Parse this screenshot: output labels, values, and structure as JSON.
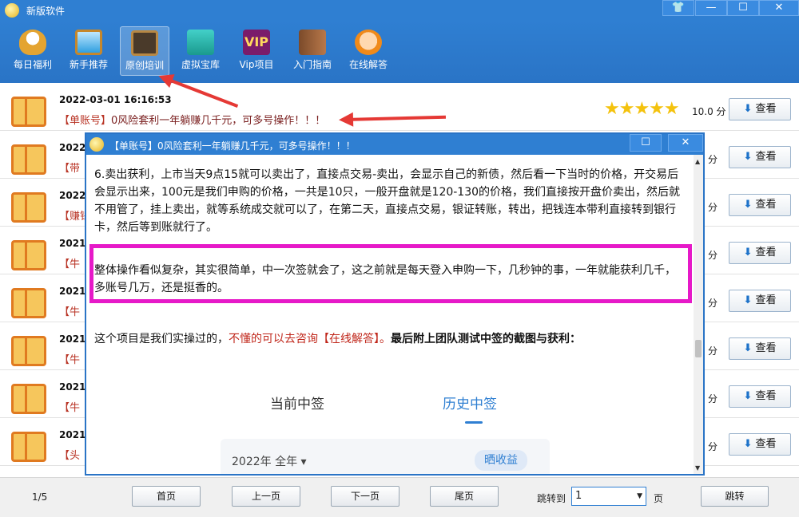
{
  "app": {
    "title": "新版软件"
  },
  "window_controls": {
    "skin": "👕",
    "minimize": "—",
    "maximize": "☐",
    "close": "✕"
  },
  "toolbar": {
    "items": [
      {
        "label": "每日福利",
        "icon": "lucky-cat-icon"
      },
      {
        "label": "新手推荐",
        "icon": "monitor-icon"
      },
      {
        "label": "原创培训",
        "icon": "blackboard-icon",
        "active": true
      },
      {
        "label": "虚拟宝库",
        "icon": "warehouse-icon"
      },
      {
        "label": "Vip项目",
        "icon": "vip-icon",
        "icon_text": "VIP"
      },
      {
        "label": "入门指南",
        "icon": "guide-book-icon"
      },
      {
        "label": "在线解答",
        "icon": "headset-icon"
      }
    ]
  },
  "list": {
    "rows": [
      {
        "date": "2022-03-01 16:16:53",
        "tag": "【单账号】",
        "title": "0风险套利一年躺赚几千元，可多号操作！！！",
        "stars": "★★★★★",
        "score": "10.0 分",
        "action": "查看"
      },
      {
        "date": "2022",
        "tag": "【带",
        "title": "",
        "score": "分",
        "action": "查看"
      },
      {
        "date": "2022",
        "tag": "【赚钱",
        "title": "",
        "score": "分",
        "action": "查看"
      },
      {
        "date": "2021",
        "tag": "【牛",
        "title": "",
        "score": "分",
        "action": "查看"
      },
      {
        "date": "2021",
        "tag": "【牛",
        "title": "",
        "score": "分",
        "action": "查看"
      },
      {
        "date": "2021",
        "tag": "【牛",
        "title": "",
        "score": "分",
        "action": "查看"
      },
      {
        "date": "2021",
        "tag": "【牛",
        "title": "",
        "score": "分",
        "action": "查看"
      },
      {
        "date": "2021",
        "tag": "【头",
        "title": "",
        "score": "分",
        "action": "查看"
      }
    ]
  },
  "popup": {
    "title": "【单账号】0风险套利一年躺赚几千元，可多号操作！！！",
    "maximize": "☐",
    "close": "✕",
    "para1": "6.卖出获利，上市当天9点15就可以卖出了，直接点交易-卖出，会显示自己的新债，然后看一下当时的价格，开交易后会显示出来，100元是我们申购的价格，一共是10只，一般开盘就是120-130的价格，我们直接按开盘价卖出，然后就不用管了，挂上卖出，就等系统成交就可以了，在第二天，直接点交易，银证转账，转出，把钱连本带利直接转到银行卡，然后等到账就行了。",
    "para2": "整体操作看似复杂，其实很简单，中一次签就会了，这之前就是每天登入申购一下，几秒钟的事，一年就能获利几千，多账号几万，还是挺香的。",
    "para3_a": "这个项目是我们实操过的，",
    "para3_b": "不懂的可以去咨询【在线解答】。",
    "para3_c": "最后附上团队测试中签的截图与获利：",
    "screenshot": {
      "tab_current": "当前中签",
      "tab_history": "历史中签",
      "year_filter": "2022年 全年 ▾",
      "earnings": "晒收益"
    }
  },
  "footer": {
    "page_indicator": "1/5",
    "first": "首页",
    "prev": "上一页",
    "next": "下一页",
    "last": "尾页",
    "goto_label": "跳转到",
    "goto_value": "1",
    "goto_unit": "页",
    "jump": "跳转"
  },
  "colors": {
    "accent": "#2f7fd2",
    "highlight": "#e619c8",
    "arrow": "#e53935",
    "star": "#f4c20d"
  }
}
